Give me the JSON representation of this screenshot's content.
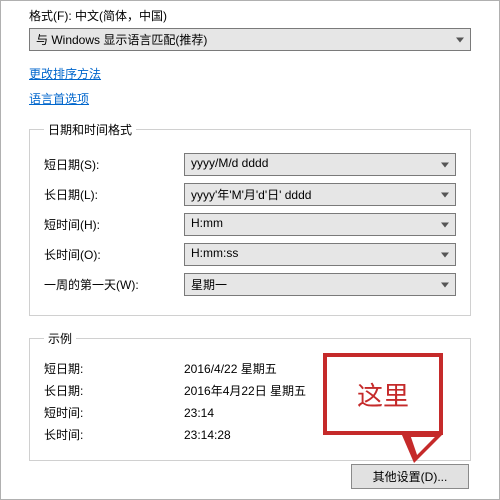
{
  "format": {
    "label": "格式(F): 中文(简体，中国)",
    "combo_value": "与 Windows 显示语言匹配(推荐)"
  },
  "links": {
    "change_sort": "更改排序方法",
    "lang_prefs": "语言首选项"
  },
  "datetime_group": {
    "legend": "日期和时间格式",
    "short_date_label": "短日期(S):",
    "short_date_value": "yyyy/M/d dddd",
    "long_date_label": "长日期(L):",
    "long_date_value": "yyyy'年'M'月'd'日' dddd",
    "short_time_label": "短时间(H):",
    "short_time_value": "H:mm",
    "long_time_label": "长时间(O):",
    "long_time_value": "H:mm:ss",
    "first_day_label": "一周的第一天(W):",
    "first_day_value": "星期一"
  },
  "examples": {
    "legend": "示例",
    "short_date_label": "短日期:",
    "short_date_value": "2016/4/22 星期五",
    "long_date_label": "长日期:",
    "long_date_value": "2016年4月22日 星期五",
    "short_time_label": "短时间:",
    "short_time_value": "23:14",
    "long_time_label": "长时间:",
    "long_time_value": "23:14:28"
  },
  "other_settings_button": "其他设置(D)...",
  "annotation_text": "这里"
}
